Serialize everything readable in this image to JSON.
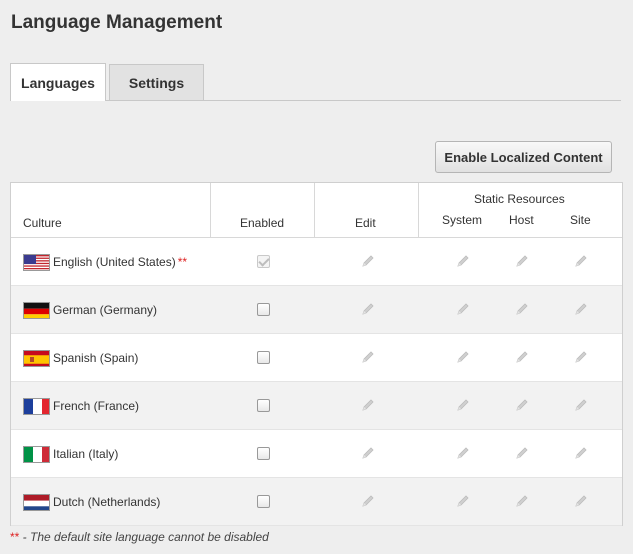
{
  "page_title": "Language Management",
  "tabs": [
    {
      "label": "Languages",
      "active": true
    },
    {
      "label": "Settings",
      "active": false
    }
  ],
  "enable_button_label": "Enable Localized Content",
  "grid": {
    "headers": {
      "culture": "Culture",
      "enabled": "Enabled",
      "edit": "Edit",
      "static_resources": "Static Resources",
      "system": "System",
      "host": "Host",
      "site": "Site"
    },
    "rows": [
      {
        "culture": "English (United States)",
        "flag": "flag-us-icon",
        "enabled": true,
        "default_marker": "**"
      },
      {
        "culture": "German (Germany)",
        "flag": "flag-de-icon",
        "enabled": false,
        "default_marker": ""
      },
      {
        "culture": "Spanish (Spain)",
        "flag": "flag-es-icon",
        "enabled": false,
        "default_marker": ""
      },
      {
        "culture": "French (France)",
        "flag": "flag-fr-icon",
        "enabled": false,
        "default_marker": ""
      },
      {
        "culture": "Italian (Italy)",
        "flag": "flag-it-icon",
        "enabled": false,
        "default_marker": ""
      },
      {
        "culture": "Dutch (Netherlands)",
        "flag": "flag-nl-icon",
        "enabled": false,
        "default_marker": ""
      }
    ]
  },
  "footnote": {
    "marker": "**",
    "text": " - The default site language cannot be disabled"
  },
  "colors": {
    "background": "#eeeeee",
    "required_marker": "#dd2222",
    "row_alt": "#f2f2f2"
  }
}
